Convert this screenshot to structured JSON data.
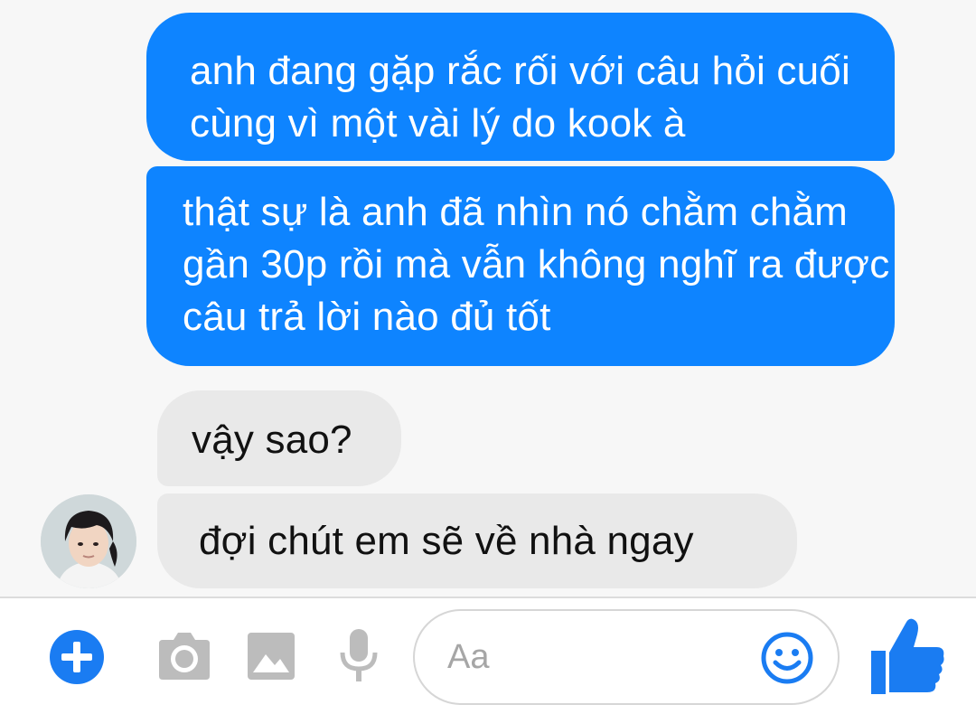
{
  "conversation": {
    "messages": [
      {
        "direction": "sent",
        "text": "anh đang gặp rắc rối với câu hỏi cuối cùng vì một vài lý do kook à"
      },
      {
        "direction": "sent",
        "text": "thật sự là anh đã nhìn nó chằm chằm gần 30p rồi mà vẫn không nghĩ ra được câu trả lời nào đủ tốt"
      },
      {
        "direction": "received",
        "text": "vậy sao?"
      },
      {
        "direction": "received",
        "text": "đợi chút em sẽ về nhà ngay"
      }
    ]
  },
  "composer": {
    "placeholder": "Aa",
    "icons": [
      "plus-icon",
      "camera-icon",
      "image-icon",
      "microphone-icon",
      "emoji-icon",
      "thumbs-up-icon"
    ]
  },
  "colors": {
    "sent_bubble": "#0e84ff",
    "received_bubble": "#e9e9e9",
    "accent": "#1a7cf2",
    "toolbar_icon_gray": "#bcbcbc"
  }
}
